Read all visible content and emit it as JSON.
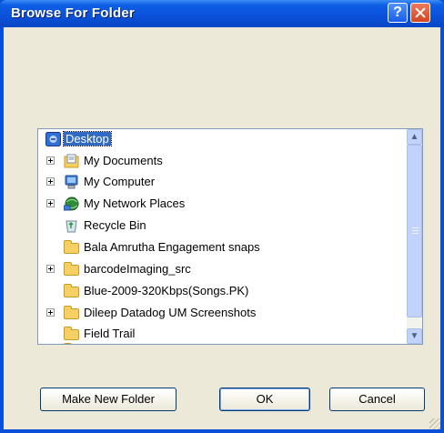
{
  "window": {
    "title": "Browse For Folder",
    "help_glyph": "?"
  },
  "tree": {
    "items": [
      {
        "label": "Desktop",
        "icon": "desktop-icon",
        "expandable": false,
        "selected": true
      },
      {
        "label": "My Documents",
        "icon": "documents-icon",
        "expandable": true
      },
      {
        "label": "My Computer",
        "icon": "computer-icon",
        "expandable": true
      },
      {
        "label": "My Network Places",
        "icon": "network-icon",
        "expandable": true
      },
      {
        "label": "Recycle Bin",
        "icon": "recycle-bin-icon",
        "expandable": false
      },
      {
        "label": "Bala Amrutha Engagement snaps",
        "icon": "folder-icon",
        "expandable": false
      },
      {
        "label": "barcodeImaging_src",
        "icon": "folder-icon",
        "expandable": true
      },
      {
        "label": "Blue-2009-320Kbps(Songs.PK)",
        "icon": "folder-icon",
        "expandable": false
      },
      {
        "label": "Dileep Datadog UM Screenshots",
        "icon": "folder-icon",
        "expandable": true
      },
      {
        "label": "Field Trail",
        "icon": "folder-icon",
        "expandable": false
      }
    ]
  },
  "buttons": {
    "make_new_folder": "Make New Folder",
    "ok": "OK",
    "cancel": "Cancel"
  },
  "colors": {
    "title_bar": "#0a50d8",
    "selection": "#316ac5",
    "dialog_bg": "#ece9d8"
  }
}
